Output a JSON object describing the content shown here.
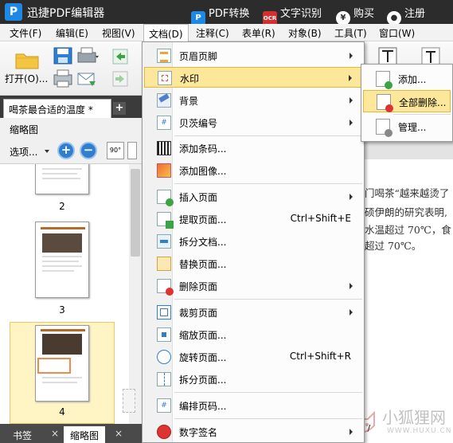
{
  "app": {
    "title": "迅捷PDF编辑器",
    "pdf_convert": "PDF转换",
    "ocr_badge": "OCR",
    "ocr": "文字识别",
    "buy_icon": "¥",
    "buy": "购买",
    "register": "注册"
  },
  "menubar": [
    "文件(F)",
    "编辑(E)",
    "视图(V)",
    "文档(D)",
    "注释(C)",
    "表单(R)",
    "对象(B)",
    "工具(T)",
    "窗口(W)"
  ],
  "toolbar": {
    "open_label": "打开(O)..."
  },
  "tab": {
    "name": "喝茶最合适的温度 *",
    "close_glyph": "+"
  },
  "panel": {
    "title": "缩略图",
    "options": "选项...",
    "zoom_in": "+",
    "zoom_out": "−",
    "rotate_badge": "90°",
    "pages": [
      "2",
      "3",
      "4"
    ]
  },
  "bottom_tabs": {
    "bookmark": "书签",
    "thumbnails": "缩略图"
  },
  "document_lines": [
    "门喝茶“越来越烫了",
    "硕伊朗的研究表明,",
    "水温超过 70℃，食",
    "超过 70℃。"
  ],
  "doc_menu": [
    {
      "label": "页眉页脚",
      "submenu": true,
      "icon": "header-footer-icon"
    },
    {
      "label": "水印",
      "submenu": true,
      "highlighted": true,
      "icon": "watermark-icon"
    },
    {
      "label": "背景",
      "submenu": true,
      "icon": "background-icon"
    },
    {
      "label": "贝茨编号",
      "submenu": true,
      "icon": "bates-number-icon"
    },
    {
      "label": "添加条码...",
      "icon": "barcode-icon"
    },
    {
      "label": "添加图像...",
      "icon": "add-image-icon"
    },
    {
      "label": "插入页面",
      "submenu": true,
      "icon": "insert-page-icon"
    },
    {
      "label": "提取页面...",
      "shortcut": "Ctrl+Shift+E",
      "icon": "extract-page-icon"
    },
    {
      "label": "拆分文档...",
      "icon": "split-document-icon"
    },
    {
      "label": "替换页面...",
      "icon": "replace-page-icon"
    },
    {
      "label": "删除页面",
      "submenu": true,
      "icon": "delete-page-icon"
    },
    {
      "label": "裁剪页面",
      "submenu": true,
      "icon": "crop-page-icon"
    },
    {
      "label": "缩放页面...",
      "icon": "resize-page-icon"
    },
    {
      "label": "旋转页面...",
      "shortcut": "Ctrl+Shift+R",
      "icon": "rotate-page-icon"
    },
    {
      "label": "拆分页面...",
      "icon": "split-page-icon"
    },
    {
      "label": "编排页码...",
      "icon": "page-numbering-icon"
    },
    {
      "label": "数字签名",
      "submenu": true,
      "icon": "digital-signature-icon"
    }
  ],
  "watermark_menu": [
    {
      "label": "添加...",
      "icon": "add-watermark-icon"
    },
    {
      "label": "全部删除...",
      "highlighted": true,
      "icon": "remove-all-watermark-icon"
    },
    {
      "label": "管理...",
      "icon": "manage-watermark-icon"
    }
  ],
  "status": {
    "page_indicator": "4 /"
  },
  "site_watermark": {
    "text": "小狐狸网",
    "sub": "WWW.HUXU.CN"
  },
  "colors": {
    "menu_highlight": "#fde79a",
    "menu_highlight_border": "#e7b937",
    "titlebar": "#2c2c2c",
    "accent": "#1e88e5"
  }
}
